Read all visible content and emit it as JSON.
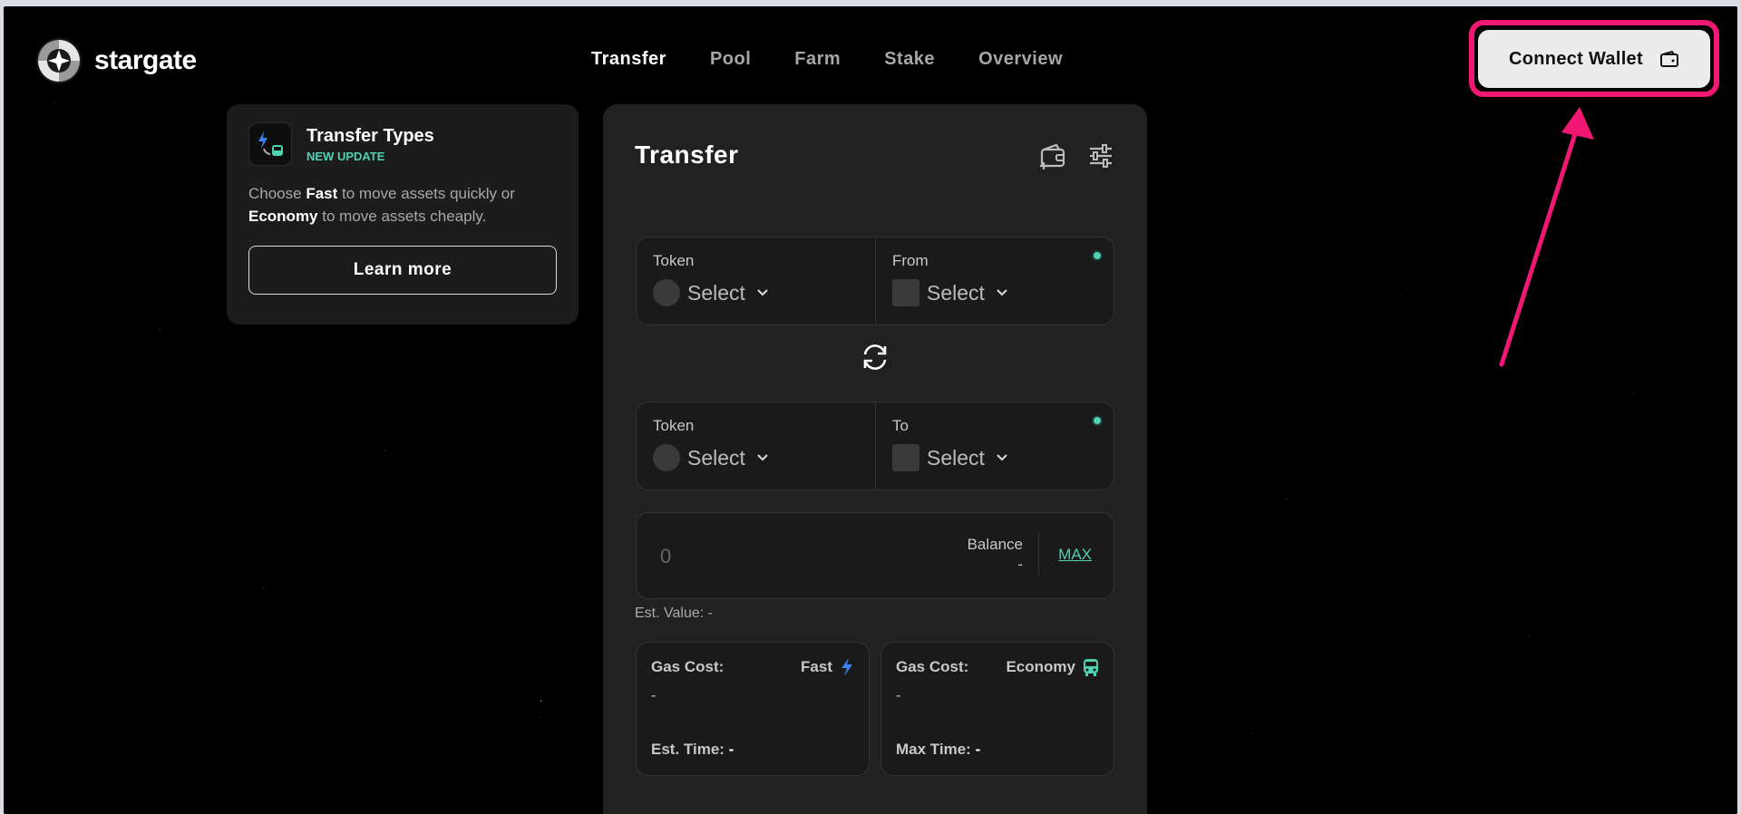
{
  "brand": {
    "name": "stargate"
  },
  "nav": {
    "items": [
      {
        "label": "Transfer",
        "active": true
      },
      {
        "label": "Pool",
        "active": false
      },
      {
        "label": "Farm",
        "active": false
      },
      {
        "label": "Stake",
        "active": false
      },
      {
        "label": "Overview",
        "active": false
      }
    ]
  },
  "header": {
    "connect_label": "Connect Wallet",
    "connect_icon": "wallet-icon",
    "highlight_color": "#f01872"
  },
  "promo": {
    "title": "Transfer Types",
    "badge": "NEW UPDATE",
    "text_1": "Choose ",
    "fast": "Fast",
    "text_2": " to move assets quickly or ",
    "economy": "Economy",
    "text_3": " to move assets cheaply.",
    "button": "Learn more"
  },
  "transfer": {
    "title": "Transfer",
    "source": {
      "token_label": "Token",
      "token_value": "Select",
      "chain_label": "From",
      "chain_value": "Select"
    },
    "dest": {
      "token_label": "Token",
      "token_value": "Select",
      "chain_label": "To",
      "chain_value": "Select"
    },
    "amount": {
      "value": "0",
      "balance_label": "Balance",
      "balance_value": "-",
      "max_label": "MAX"
    },
    "est_value": "Est. Value: -",
    "fast": {
      "gas_label": "Gas Cost:",
      "type": "Fast",
      "gas_value": "-",
      "time_label": "Est. Time:",
      "time_value": "-"
    },
    "economy": {
      "gas_label": "Gas Cost:",
      "type": "Economy",
      "gas_value": "-",
      "time_label": "Max Time:",
      "time_value": "-"
    }
  },
  "colors": {
    "accent": "#4fd1b4",
    "fast_icon": "#3b82f6",
    "panel": "#212121"
  }
}
